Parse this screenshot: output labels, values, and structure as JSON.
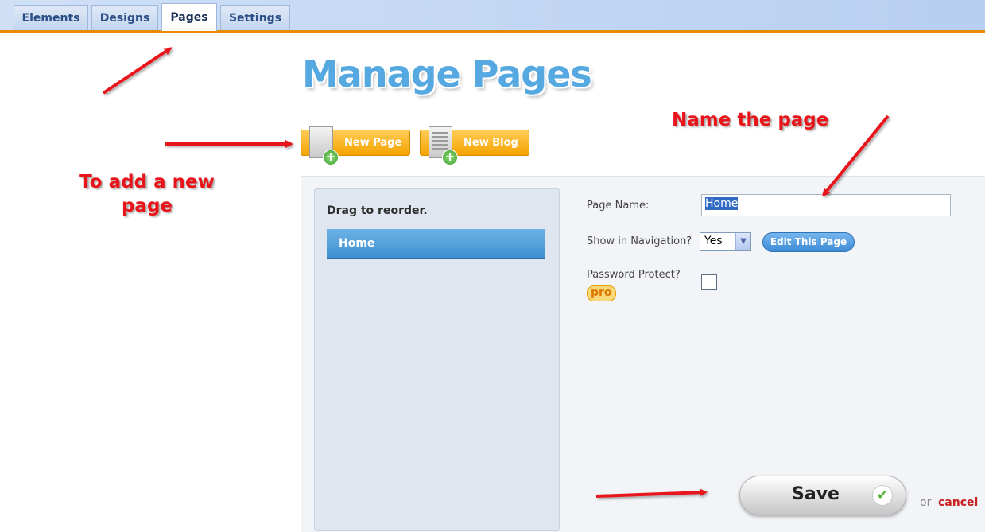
{
  "tabs": [
    {
      "label": "Elements"
    },
    {
      "label": "Designs"
    },
    {
      "label": "Pages"
    },
    {
      "label": "Settings"
    }
  ],
  "active_tab": "Pages",
  "title": "Manage Pages",
  "buttons": {
    "new_page": "New Page",
    "new_blog": "New Blog",
    "edit_page": "Edit This Page",
    "save": "Save",
    "cancel": "cancel",
    "or": "or"
  },
  "reorder": {
    "label": "Drag to reorder.",
    "pages": [
      "Home"
    ]
  },
  "form": {
    "page_name_label": "Page Name:",
    "page_name_value": "Home",
    "show_nav_label": "Show in Navigation?",
    "show_nav_value": "Yes",
    "password_label": "Password Protect?",
    "password_checked": false,
    "pro_badge": "pro"
  },
  "annotations": {
    "add_page": "To add a new page",
    "add_page_line1": "To add a new",
    "add_page_line2": "page",
    "name_page": "Name the page"
  },
  "colors": {
    "annotation": "#e8141a",
    "accent_orange": "#f5a300",
    "title_blue": "#55a8e0"
  }
}
